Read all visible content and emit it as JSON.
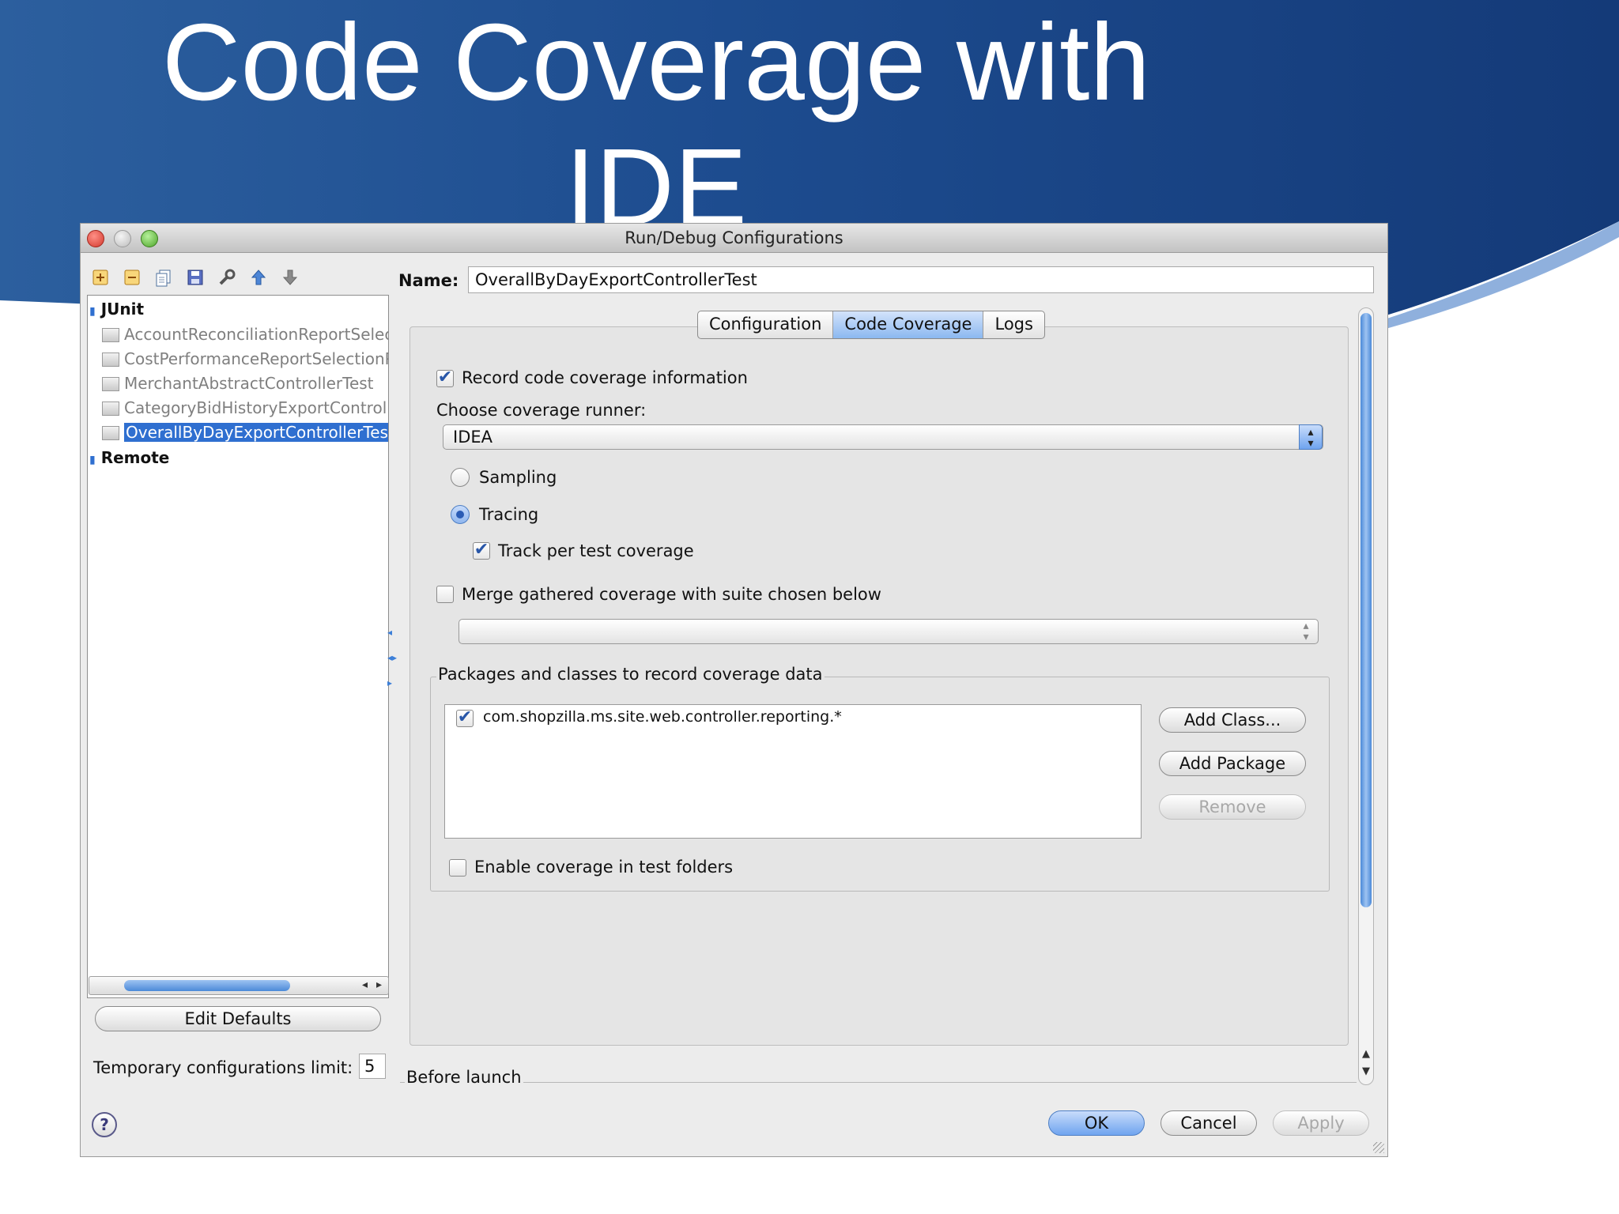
{
  "slide": {
    "title_line1": "Code Coverage with",
    "title_line2": "IDE",
    "bg_color": "#1c4f94",
    "accent_color": "#3f7cc8"
  },
  "window": {
    "title": "Run/Debug Configurations",
    "toolbar_icons": [
      "add-icon",
      "remove-icon",
      "copy-icon",
      "save-icon",
      "wrench-icon",
      "arrow-up-icon",
      "arrow-down-icon"
    ]
  },
  "name_field": {
    "label": "Name:",
    "value": "OverallByDayExportControllerTest"
  },
  "tree": {
    "groups": [
      {
        "label": "JUnit",
        "items": [
          "AccountReconciliationReportSelecti",
          "CostPerformanceReportSelectionP",
          "MerchantAbstractControllerTest",
          "CategoryBidHistoryExportControlle",
          "OverallByDayExportControllerTest"
        ],
        "selected": "OverallByDayExportControllerTest"
      },
      {
        "label": "Remote",
        "items": []
      }
    ]
  },
  "edit_defaults_label": "Edit Defaults",
  "temp_limit": {
    "label": "Temporary configurations limit:",
    "value": "5"
  },
  "tabs": [
    "Configuration",
    "Code Coverage",
    "Logs"
  ],
  "active_tab": "Code Coverage",
  "coverage": {
    "record_label": "Record code coverage information",
    "record_checked": true,
    "runner_label": "Choose coverage runner:",
    "runner_value": "IDEA",
    "sampling_label": "Sampling",
    "tracing_label": "Tracing",
    "selected_mode": "Tracing",
    "track_label": "Track per test coverage",
    "track_checked": true,
    "merge_label": "Merge gathered coverage with suite chosen below",
    "merge_checked": false,
    "merge_suite_value": "",
    "packages_title": "Packages and classes to record coverage data",
    "packages": [
      {
        "pattern": "com.shopzilla.ms.site.web.controller.reporting.*",
        "checked": true
      }
    ],
    "add_class_label": "Add Class...",
    "add_package_label": "Add Package",
    "remove_label": "Remove",
    "enable_test_folders_label": "Enable coverage in test folders",
    "enable_test_folders_checked": false
  },
  "before_launch_label": "Before launch",
  "buttons": {
    "ok": "OK",
    "cancel": "Cancel",
    "apply": "Apply"
  },
  "help_label": "?"
}
